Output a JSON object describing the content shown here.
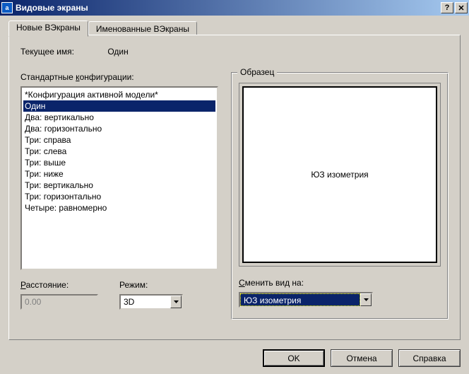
{
  "window": {
    "title": "Видовые экраны"
  },
  "tabs": {
    "new": "Новые ВЭкраны",
    "named": "Именованные ВЭкраны"
  },
  "current": {
    "label": "Текущее имя:",
    "value": "Один"
  },
  "configs": {
    "label_pre": "Стандартные ",
    "label_u": "к",
    "label_post": "онфигурации:",
    "items": [
      "*Конфигурация активной модели*",
      "Один",
      "Два: вертикально",
      "Два: горизонтально",
      "Три: справа",
      "Три: слева",
      "Три: выше",
      "Три: ниже",
      "Три: вертикально",
      "Три: горизонтально",
      "Четыре: равномерно"
    ],
    "selected_index": 1
  },
  "distance": {
    "label_u": "Р",
    "label_post": "асстояние:",
    "value": "0.00"
  },
  "mode": {
    "label": "Режим:",
    "value": "3D"
  },
  "sample": {
    "group_title": "Образец",
    "preview_text": "ЮЗ изометрия"
  },
  "change": {
    "label_u": "С",
    "label_post": "менить вид на:",
    "value": "ЮЗ изометрия"
  },
  "buttons": {
    "ok": "OK",
    "cancel": "Отмена",
    "help": "Справка"
  }
}
